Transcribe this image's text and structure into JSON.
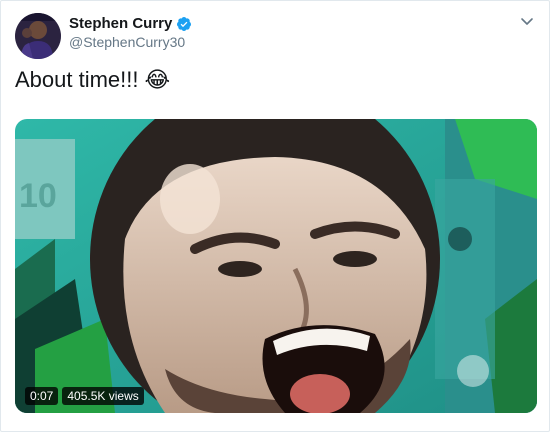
{
  "author": {
    "display_name": "Stephen Curry",
    "handle": "@StephenCurry30",
    "verified_icon": "verified-badge-icon"
  },
  "tweet": {
    "text": "About time!!!",
    "emoji": "😂"
  },
  "media": {
    "type": "video",
    "duration": "0:07",
    "views": "405.5K views"
  },
  "colors": {
    "verified_blue": "#1da1f2",
    "text_primary": "#14171a",
    "text_secondary": "#657786"
  }
}
